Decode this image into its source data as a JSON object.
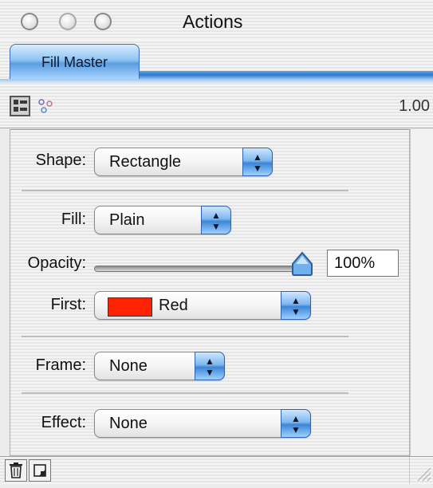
{
  "window": {
    "title": "Actions"
  },
  "tabs": [
    {
      "label": "Fill Master",
      "active": true
    }
  ],
  "toolbar": {
    "version": "1.00"
  },
  "fields": {
    "shape": {
      "label": "Shape:",
      "value": "Rectangle"
    },
    "fill": {
      "label": "Fill:",
      "value": "Plain"
    },
    "opacity": {
      "label": "Opacity:",
      "value": "100%",
      "level": 1.0
    },
    "first": {
      "label": "First:",
      "value": "Red",
      "swatch_color": "#ff2200"
    },
    "frame": {
      "label": "Frame:",
      "value": "None"
    },
    "effect": {
      "label": "Effect:",
      "value": "None"
    }
  },
  "colors": {
    "accent_blue": "#4a90de"
  },
  "bottom_bar": {
    "delete_icon": "trash-icon",
    "new_icon": "new-item-icon"
  }
}
